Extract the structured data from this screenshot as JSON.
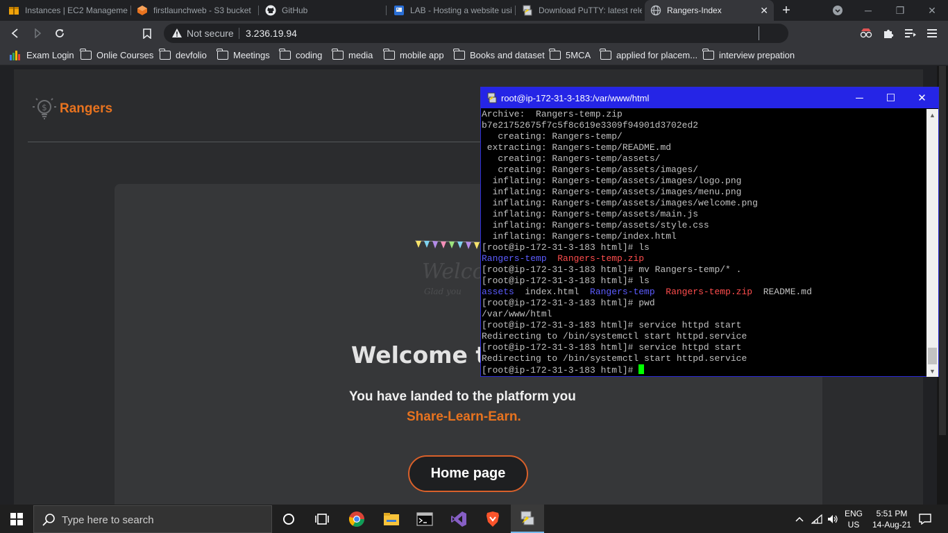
{
  "browser": {
    "tabs": [
      {
        "label": "Instances | EC2 Managemen",
        "icon": "aws-ec2-icon"
      },
      {
        "label": "firstlaunchweb - S3 bucket",
        "icon": "aws-s3-icon"
      },
      {
        "label": "GitHub",
        "icon": "github-icon"
      },
      {
        "label": "LAB - Hosting a website usi",
        "icon": "document-icon"
      },
      {
        "label": "Download PuTTY: latest rele",
        "icon": "putty-icon"
      },
      {
        "label": "Rangers-Index",
        "icon": "globe-icon",
        "active": true
      }
    ],
    "new_tab": "+",
    "address": {
      "security": "Not secure",
      "url": "3.236.19.94"
    },
    "bookmarks": [
      {
        "label": "Exam Login",
        "icon": "chart-icon"
      },
      {
        "label": "Onlie Courses",
        "icon": "folder-icon"
      },
      {
        "label": "devfolio",
        "icon": "folder-icon"
      },
      {
        "label": "Meetings",
        "icon": "folder-icon"
      },
      {
        "label": "coding",
        "icon": "folder-icon"
      },
      {
        "label": "media",
        "icon": "folder-icon"
      },
      {
        "label": "mobile app",
        "icon": "folder-icon"
      },
      {
        "label": "Books and dataset",
        "icon": "folder-icon"
      },
      {
        "label": "5MCA",
        "icon": "folder-icon"
      },
      {
        "label": "applied for placem...",
        "icon": "folder-icon"
      },
      {
        "label": "interview prepation",
        "icon": "folder-icon"
      }
    ]
  },
  "site": {
    "logo_text": "Rangers",
    "welcome_script": "Welco",
    "welcome_sub": "Glad you",
    "title": "Welcome to",
    "line1": "You have landed to the platform you",
    "line2": "Share-Learn-Earn.",
    "button": "Home page",
    "accent": "#e8731f"
  },
  "putty": {
    "title": "root@ip-172-31-3-183:/var/www/html",
    "lines": [
      [
        {
          "t": "Archive:  Rangers-temp.zip"
        }
      ],
      [
        {
          "t": "b7e21752675f7c5f8c619e3309f94901d3702ed2"
        }
      ],
      [
        {
          "t": "   creating: Rangers-temp/"
        }
      ],
      [
        {
          "t": " extracting: Rangers-temp/README.md"
        }
      ],
      [
        {
          "t": "   creating: Rangers-temp/assets/"
        }
      ],
      [
        {
          "t": "   creating: Rangers-temp/assets/images/"
        }
      ],
      [
        {
          "t": "  inflating: Rangers-temp/assets/images/logo.png"
        }
      ],
      [
        {
          "t": "  inflating: Rangers-temp/assets/images/menu.png"
        }
      ],
      [
        {
          "t": "  inflating: Rangers-temp/assets/images/welcome.png"
        }
      ],
      [
        {
          "t": "  inflating: Rangers-temp/assets/main.js"
        }
      ],
      [
        {
          "t": "  inflating: Rangers-temp/assets/style.css"
        }
      ],
      [
        {
          "t": "  inflating: Rangers-temp/index.html"
        }
      ],
      [
        {
          "t": "[root@ip-172-31-3-183 html]# ls"
        }
      ],
      [
        {
          "t": "Rangers-temp",
          "c": "blue"
        },
        {
          "t": "  "
        },
        {
          "t": "Rangers-temp.zip",
          "c": "red"
        }
      ],
      [
        {
          "t": "[root@ip-172-31-3-183 html]# mv Rangers-temp/* ."
        }
      ],
      [
        {
          "t": "[root@ip-172-31-3-183 html]# ls"
        }
      ],
      [
        {
          "t": "assets",
          "c": "blue"
        },
        {
          "t": "  index.html  "
        },
        {
          "t": "Rangers-temp",
          "c": "blue"
        },
        {
          "t": "  "
        },
        {
          "t": "Rangers-temp.zip",
          "c": "red"
        },
        {
          "t": "  README.md"
        }
      ],
      [
        {
          "t": "[root@ip-172-31-3-183 html]# pwd"
        }
      ],
      [
        {
          "t": "/var/www/html"
        }
      ],
      [
        {
          "t": "[root@ip-172-31-3-183 html]# service httpd start"
        }
      ],
      [
        {
          "t": "Redirecting to /bin/systemctl start httpd.service"
        }
      ],
      [
        {
          "t": "[root@ip-172-31-3-183 html]# service httpd start"
        }
      ],
      [
        {
          "t": "Redirecting to /bin/systemctl start httpd.service"
        }
      ],
      [
        {
          "t": "[root@ip-172-31-3-183 html]# "
        }
      ]
    ]
  },
  "taskbar": {
    "search_placeholder": "Type here to search",
    "lang_1": "ENG",
    "lang_2": "US",
    "time": "5:51 PM",
    "date": "14-Aug-21"
  }
}
